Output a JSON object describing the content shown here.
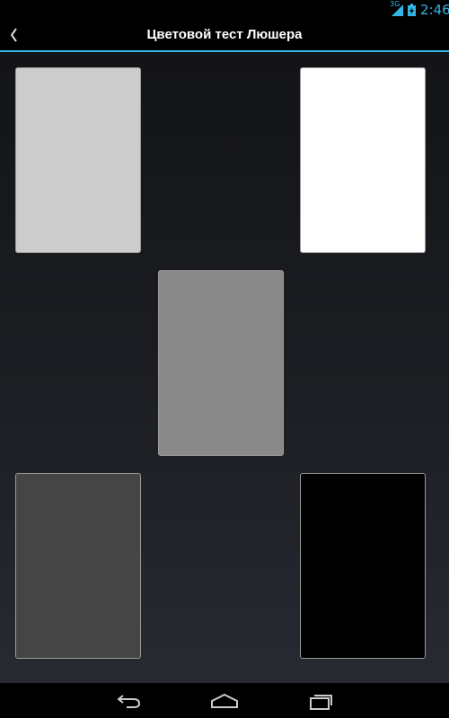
{
  "status_bar": {
    "network": "3G",
    "time": "2:46",
    "accent_color": "#33b5e5"
  },
  "action_bar": {
    "title": "Цветовой тест Люшера",
    "back_icon": "chevron-left-icon"
  },
  "color_cards": [
    {
      "name": "light-gray",
      "color": "#cccccc"
    },
    {
      "name": "white",
      "color": "#ffffff"
    },
    {
      "name": "gray",
      "color": "#898989"
    },
    {
      "name": "dark-gray",
      "color": "#454545"
    },
    {
      "name": "black",
      "color": "#000000"
    }
  ],
  "nav_bar": {
    "back_icon": "back-arrow-icon",
    "home_icon": "home-icon",
    "recent_icon": "recent-apps-icon"
  }
}
